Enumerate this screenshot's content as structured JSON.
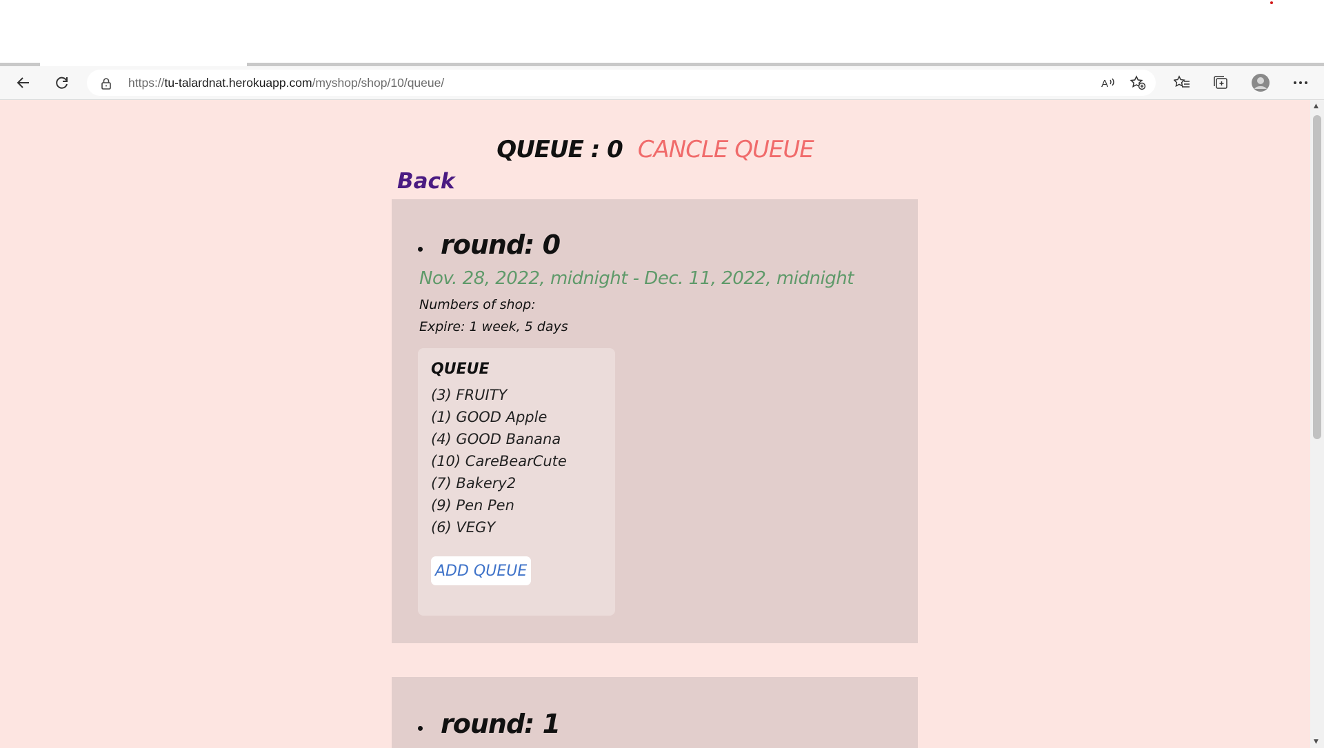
{
  "browser": {
    "url_scheme": "https://",
    "url_host": "tu-talardnat.herokuapp.com",
    "url_path": "/myshop/shop/10/queue/"
  },
  "page": {
    "queue_label": "QUEUE : 0",
    "cancel_label": "CANCLE QUEUE",
    "back_label": "Back",
    "rounds": [
      {
        "title": "round: 0",
        "date_range": "Nov. 28, 2022, midnight - Dec. 11, 2022, midnight",
        "numbers_of_shop": "Numbers of shop:",
        "expire": "Expire: 1 week, 5 days",
        "queue_heading": "QUEUE",
        "queue_items": [
          "(3) FRUITY",
          "(1) GOOD Apple",
          "(4) GOOD Banana",
          "(10) CareBearCute",
          "(7) Bakery2",
          "(9) Pen Pen",
          "(6) VEGY"
        ],
        "add_queue_label": "ADD QUEUE"
      },
      {
        "title": "round: 1"
      }
    ]
  },
  "colors": {
    "page_background": "#fde5e1",
    "card_background": "#e2cecc",
    "cancel": "#f06b6b",
    "back": "#4a1b82",
    "date": "#5f9a6a",
    "add_queue_text": "#3f73c9"
  }
}
